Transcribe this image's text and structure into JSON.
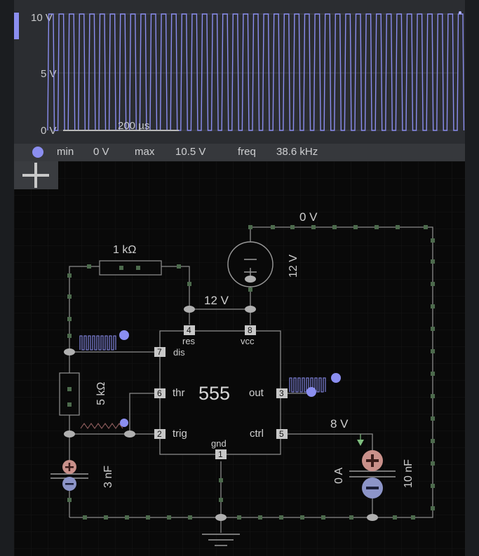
{
  "scope": {
    "y_labels": [
      "10 V",
      "5 V",
      "0 V"
    ],
    "timescale": "200 µs",
    "trace_color": "#8b8ef0"
  },
  "status": {
    "min_label": "min",
    "min_value": "0 V",
    "max_label": "max",
    "max_value": "10.5 V",
    "freq_label": "freq",
    "freq_value": "38.6 kHz"
  },
  "toolbar": {
    "add_icon": "plus-icon"
  },
  "circuit": {
    "r1_label": "1 kΩ",
    "r2_label": "5 kΩ",
    "c1_label": "3 nF",
    "c2_label": "10 nF",
    "supply_label": "12 V",
    "node_top_voltage": "0 V",
    "node_vcc_voltage": "12 V",
    "node_ctrl_voltage": "8 V",
    "current_label": "0 A",
    "chip_label": "555",
    "pins": {
      "p4": "4",
      "p8": "8",
      "p7": "7",
      "p6": "6",
      "p2": "2",
      "p3": "3",
      "p5": "5",
      "p1": "1",
      "res": "res",
      "vcc": "vcc",
      "dis": "dis",
      "thr": "thr",
      "trig": "trig",
      "out": "out",
      "ctrl": "ctrl",
      "gnd": "gnd"
    }
  }
}
